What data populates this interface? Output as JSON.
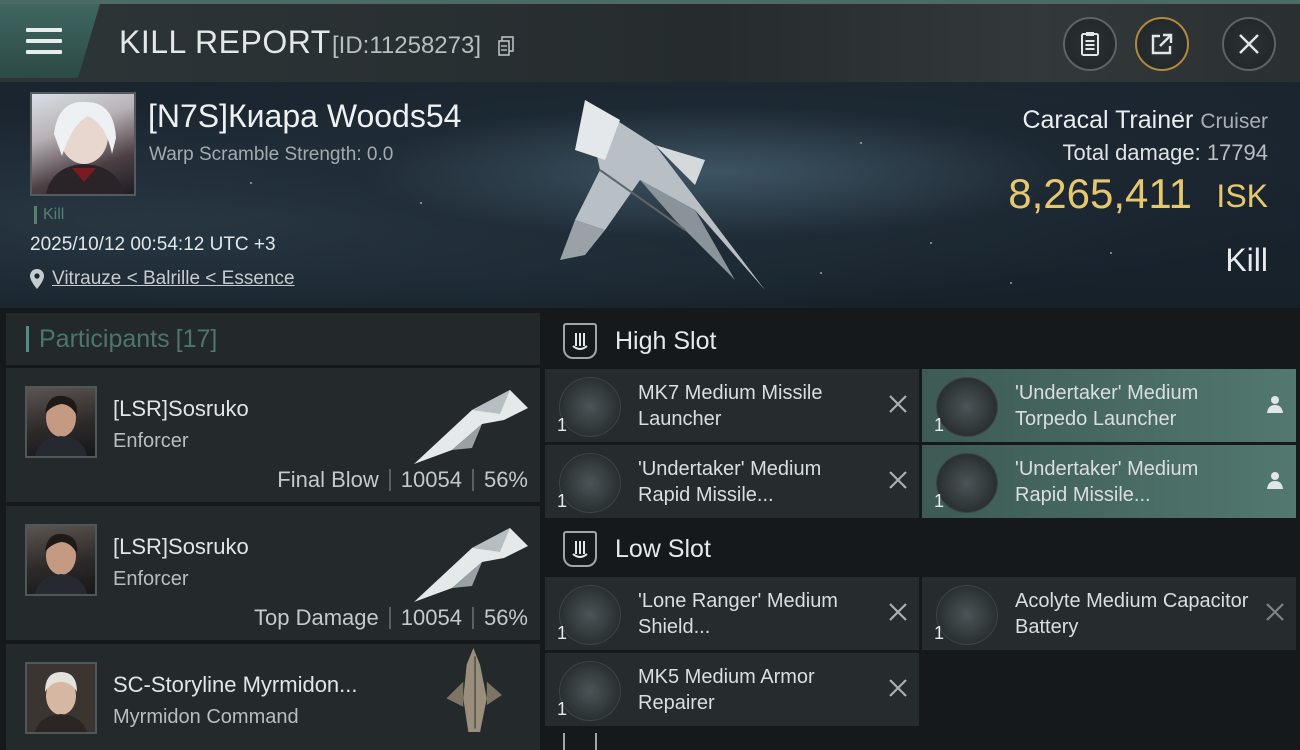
{
  "header": {
    "title": "KILL REPORT",
    "report_id": "[ID:11258273]",
    "icons": [
      "menu-icon",
      "copy-icon",
      "clipboard-icon",
      "share-icon",
      "close-icon"
    ]
  },
  "victim": {
    "name": "[N7S]Киара Woods54",
    "warp_scramble": "Warp Scramble Strength: 0.0",
    "tag": "Kill",
    "datetime": "2025/10/12 00:54:12 UTC +3",
    "location": "Vitrauze < Balrille < Essence",
    "ship_name": "Caracal Trainer",
    "ship_class": "Cruiser",
    "total_damage_label": "Total damage:",
    "total_damage_value": "17794",
    "isk_value": "8,265,411",
    "isk_unit": "ISK",
    "result": "Kill"
  },
  "participants": {
    "label": "Participants",
    "count": "[17]",
    "items": [
      {
        "name": "[LSR]Sosruko",
        "ship": "Enforcer",
        "stat_label": "Final Blow",
        "damage": "10054",
        "percent": "56%"
      },
      {
        "name": "[LSR]Sosruko",
        "ship": "Enforcer",
        "stat_label": "Top Damage",
        "damage": "10054",
        "percent": "56%"
      },
      {
        "name": "SC-Storyline Myrmidon...",
        "ship": "Myrmidon Command"
      }
    ]
  },
  "fitting": {
    "high_slot": {
      "label": "High Slot",
      "modules": [
        {
          "qty": "1",
          "name": "MK7 Medium Missile Launcher",
          "status": "destroyed"
        },
        {
          "qty": "1",
          "name": "'Undertaker' Medium Torpedo Launcher",
          "status": "dropped"
        },
        {
          "qty": "1",
          "name": "'Undertaker' Medium Rapid Missile...",
          "status": "destroyed"
        },
        {
          "qty": "1",
          "name": "'Undertaker' Medium Rapid Missile...",
          "status": "dropped"
        }
      ]
    },
    "low_slot": {
      "label": "Low Slot",
      "modules": [
        {
          "qty": "1",
          "name": "'Lone Ranger' Medium Shield...",
          "status": "destroyed"
        },
        {
          "qty": "1",
          "name": "Acolyte Medium Capacitor Battery",
          "status": "destroyed"
        },
        {
          "qty": "1",
          "name": "MK5 Medium Armor Repairer",
          "status": "destroyed"
        }
      ]
    }
  },
  "colors": {
    "accent_teal": "#4f8f85",
    "isk_gold": "#e6c86e",
    "dropped_highlight": "#52786f"
  }
}
